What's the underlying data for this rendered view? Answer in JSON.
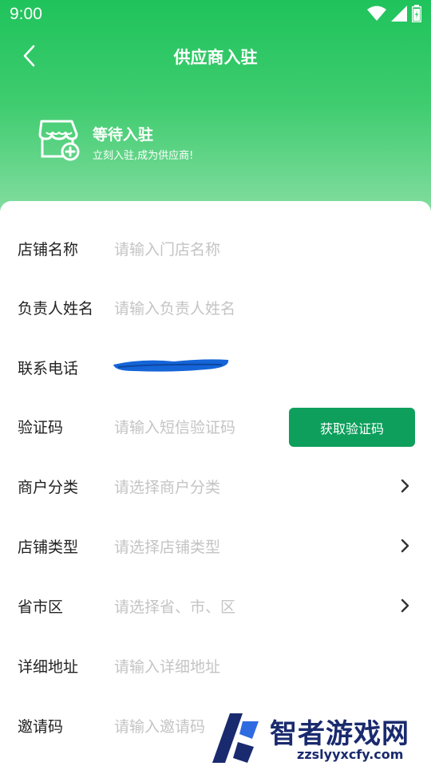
{
  "status_bar": {
    "time": "9:00"
  },
  "nav": {
    "title": "供应商入驻"
  },
  "promo": {
    "title": "等待入驻",
    "subtitle": "立刻入驻,成为供应商!"
  },
  "form": {
    "rows": [
      {
        "label": "店铺名称",
        "placeholder": "请输入门店名称"
      },
      {
        "label": "负责人姓名",
        "placeholder": "请输入负责人姓名"
      },
      {
        "label": "联系电话",
        "placeholder": ""
      },
      {
        "label": "验证码",
        "placeholder": "请输入短信验证码",
        "button": "获取验证码"
      },
      {
        "label": "商户分类",
        "placeholder": "请选择商户分类"
      },
      {
        "label": "店铺类型",
        "placeholder": "请选择店铺类型"
      },
      {
        "label": "省市区",
        "placeholder": "请选择省、市、区"
      },
      {
        "label": "详细地址",
        "placeholder": "请输入详细地址"
      },
      {
        "label": "邀请码",
        "placeholder": "请输入邀请码"
      }
    ]
  },
  "watermark": {
    "brand": "智者游戏网",
    "url": "zzslyyxcfy.com"
  },
  "colors": {
    "accent": "#0e9f5c",
    "header_gradient_top": "#1fc35c",
    "placeholder": "#c4c4c4"
  },
  "icons": [
    "wifi-icon",
    "signal-icon",
    "battery-icon",
    "back-arrow-icon",
    "store-add-icon",
    "chevron-right-icon"
  ]
}
